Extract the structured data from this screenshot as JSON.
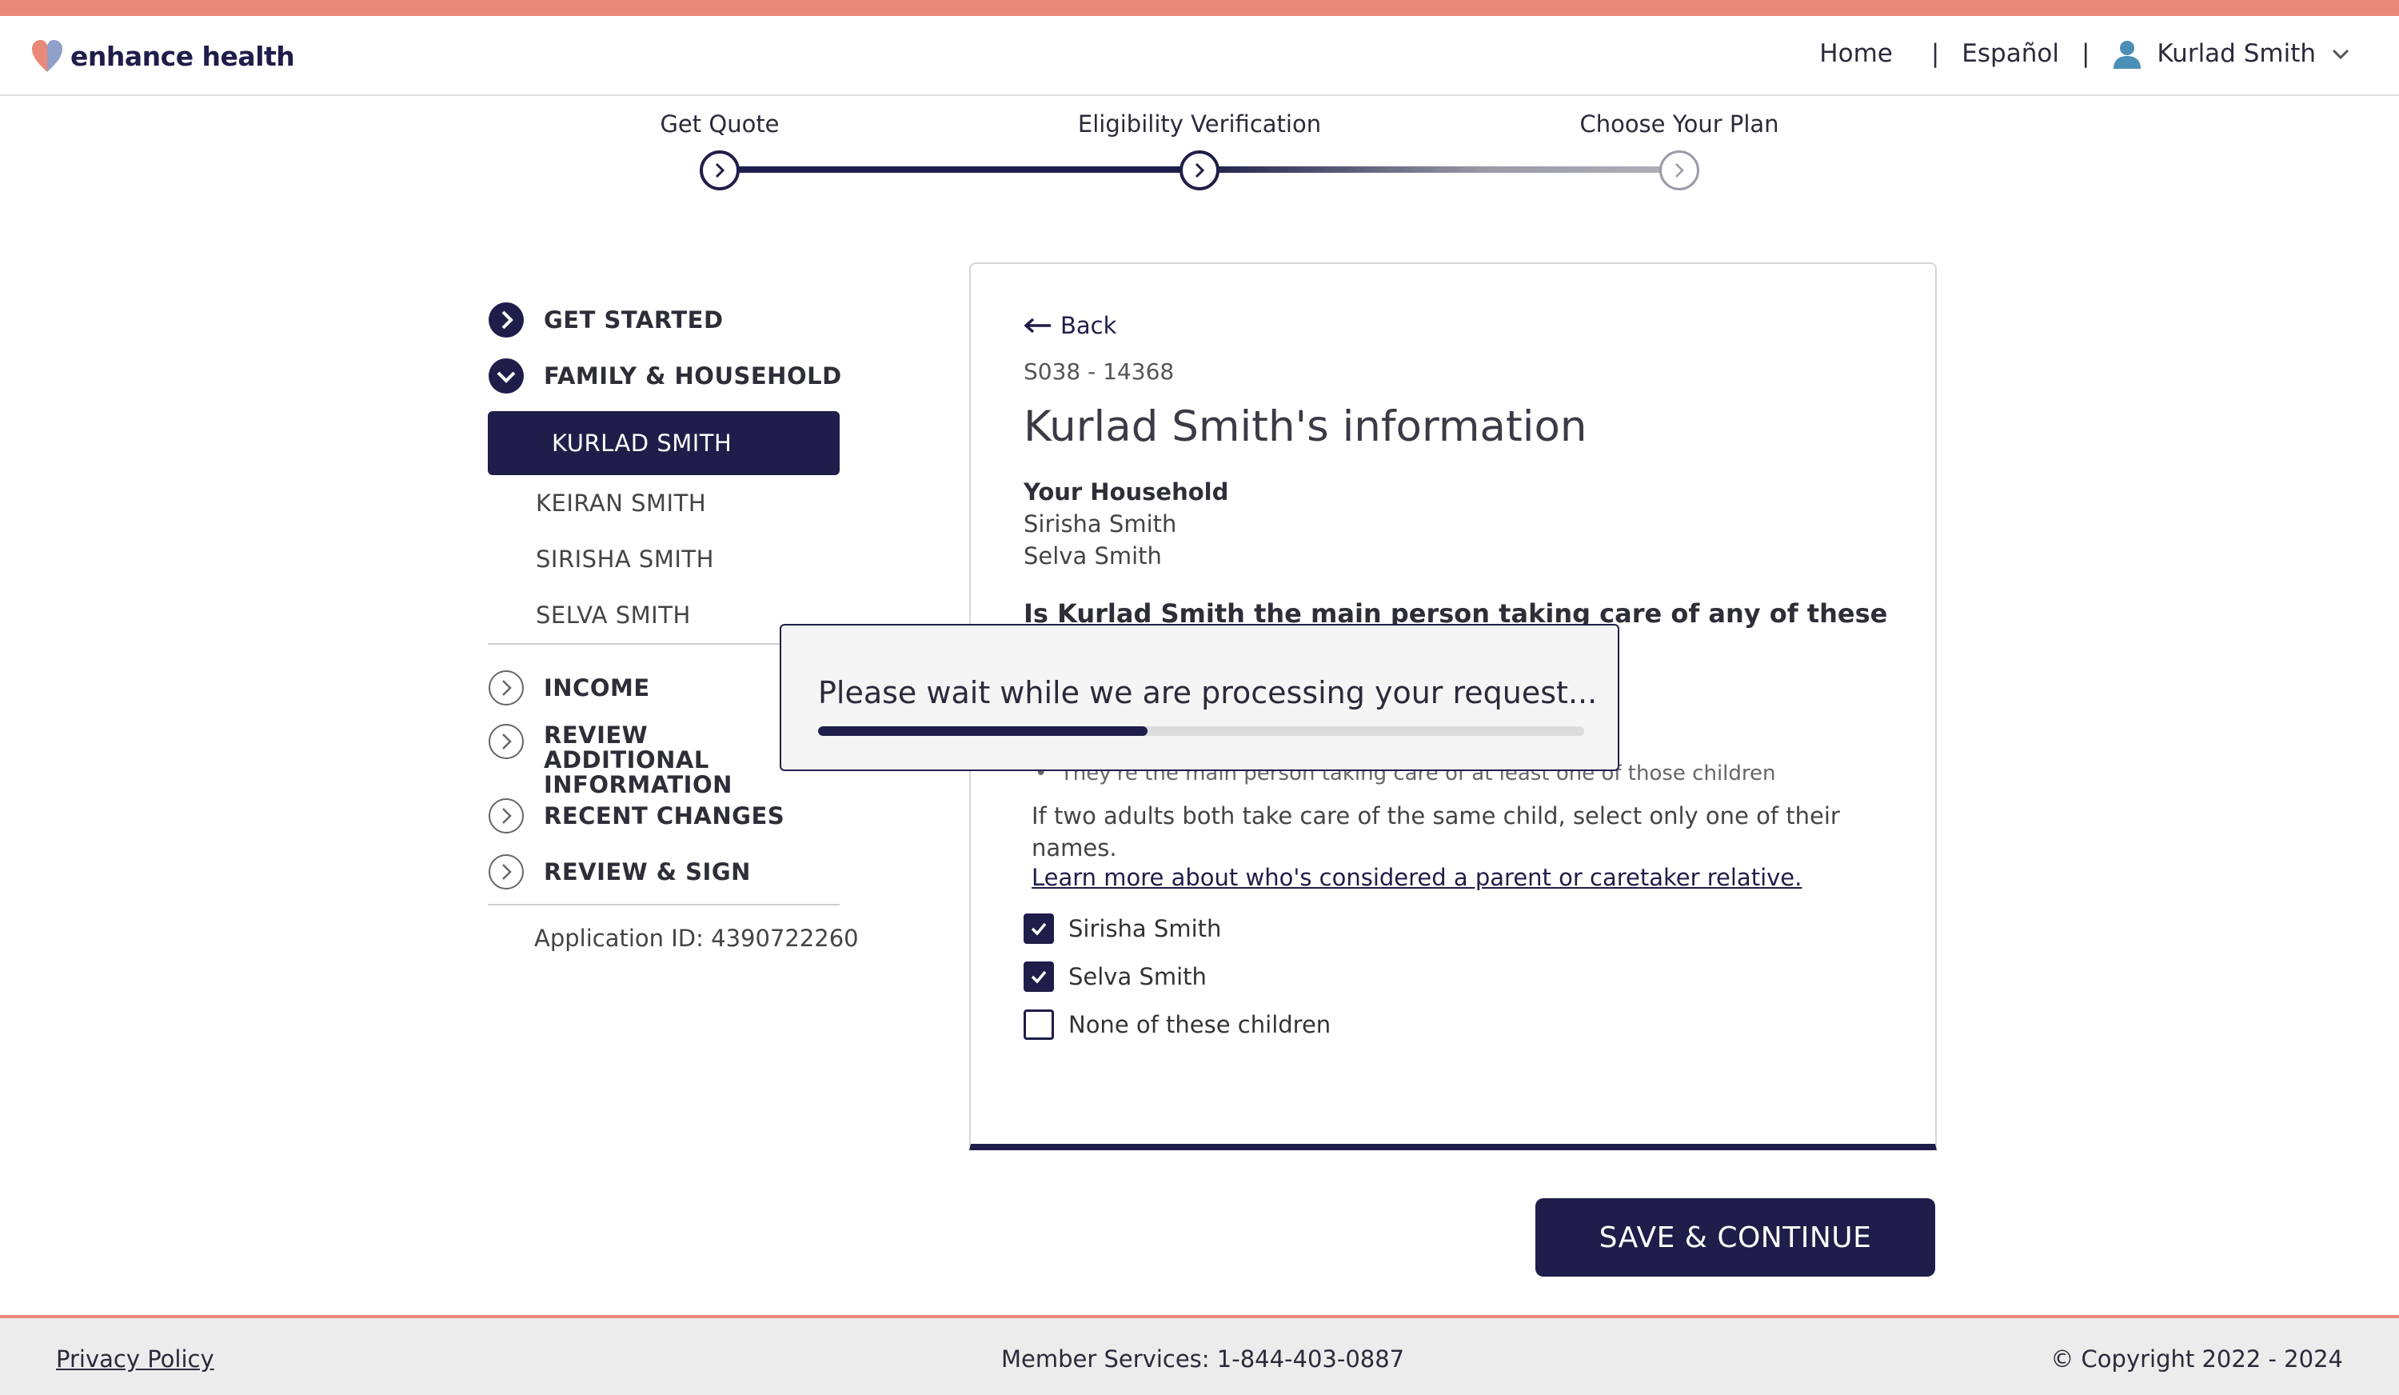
{
  "brand": {
    "name": "enhance health",
    "accent": "#e8897a",
    "primary": "#1f1e4a"
  },
  "header": {
    "nav": {
      "home": "Home",
      "language": "Español",
      "user_name": "Kurlad Smith",
      "separator": "|"
    }
  },
  "stepper": {
    "steps": [
      {
        "label": "Get Quote",
        "state": "complete"
      },
      {
        "label": "Eligibility Verification",
        "state": "current"
      },
      {
        "label": "Choose Your Plan",
        "state": "upcoming"
      }
    ]
  },
  "sidebar": {
    "get_started": "GET STARTED",
    "family_household": "FAMILY & HOUSEHOLD",
    "members": [
      "KURLAD SMITH",
      "KEIRAN SMITH",
      "SIRISHA SMITH",
      "SELVA SMITH"
    ],
    "income": "INCOME",
    "review_additional": "REVIEW ADDITIONAL INFORMATION",
    "recent_changes": "RECENT CHANGES",
    "review_sign": "REVIEW & SIGN",
    "application_id": "Application ID: 4390722260"
  },
  "card": {
    "back": "Back",
    "sub_id": "S038 - 14368",
    "title": "Kurlad Smith's information",
    "household_label": "Your Household",
    "household_members": [
      "Sirisha Smith",
      "Selva Smith"
    ],
    "question": "Is Kurlad Smith the main person taking care of any of these",
    "bullet": "They're the main person taking care of at least one of those children",
    "info": "If two adults both take care of the same child, select only one of their names.",
    "learn_more": "Learn more about who's considered a parent or caretaker relative.",
    "options": [
      {
        "label": "Sirisha Smith",
        "checked": true
      },
      {
        "label": "Selva Smith",
        "checked": true
      },
      {
        "label": "None of these children",
        "checked": false
      }
    ]
  },
  "modal": {
    "message": "Please wait while we are processing your request...",
    "progress_percent": 43
  },
  "actions": {
    "save_continue": "SAVE & CONTINUE"
  },
  "footer": {
    "privacy": "Privacy Policy",
    "member_services": "Member Services: 1-844-403-0887",
    "copyright": "© Copyright 2022 - 2024"
  }
}
